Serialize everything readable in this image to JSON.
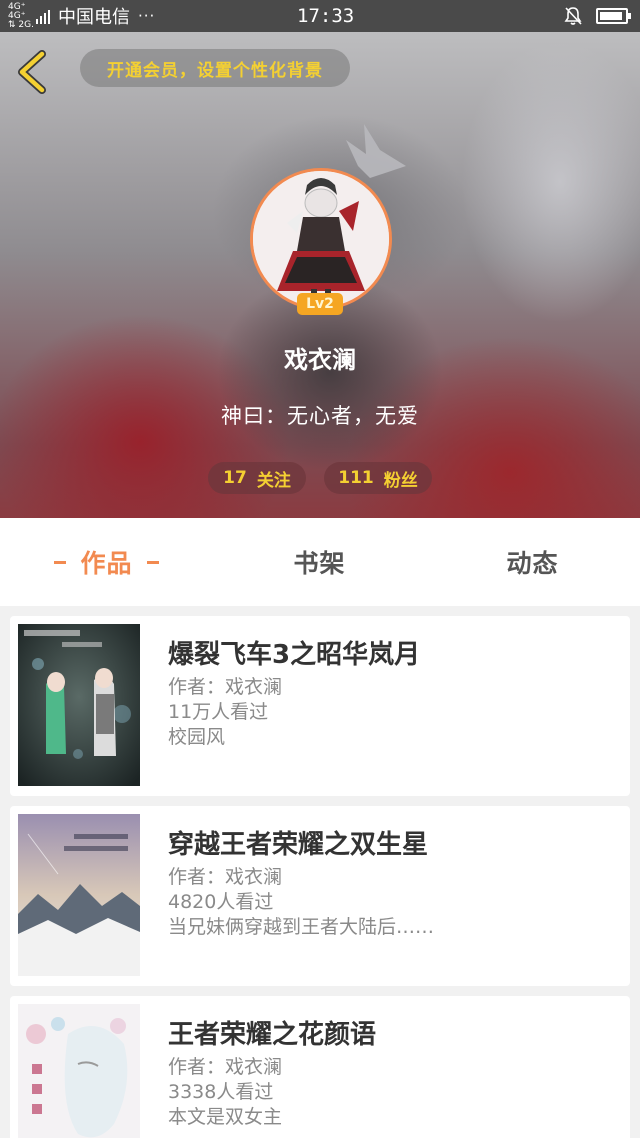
{
  "status_bar": {
    "network_top": "4G⁺ 4G⁺",
    "network_bottom": "⇅ 2G.",
    "carrier": "中国电信",
    "more": "···",
    "time": "17:33",
    "battery_level": 0.9
  },
  "header": {
    "vip_prompt": "开通会员，设置个性化背景",
    "level": "Lv2",
    "nickname": "戏衣澜",
    "signature": "神曰：无心者，无爱",
    "follow_count": "17",
    "follow_label": "关注",
    "fans_count": "111",
    "fans_label": "粉丝",
    "colors": {
      "accent": "#f28a50",
      "gold": "#f4d032"
    }
  },
  "tabs": [
    {
      "label": "作品",
      "active": true
    },
    {
      "label": "书架",
      "active": false
    },
    {
      "label": "动态",
      "active": false
    }
  ],
  "books": [
    {
      "title": "爆裂飞车3之昭华岚月",
      "author": "作者：戏衣澜",
      "views": "11万人看过",
      "desc": "校园风"
    },
    {
      "title": "穿越王者荣耀之双生星",
      "author": "作者：戏衣澜",
      "views": "4820人看过",
      "desc": "当兄妹俩穿越到王者大陆后……"
    },
    {
      "title": "王者荣耀之花颜语",
      "author": "作者：戏衣澜",
      "views": "3338人看过",
      "desc": "本文是双女主"
    }
  ]
}
